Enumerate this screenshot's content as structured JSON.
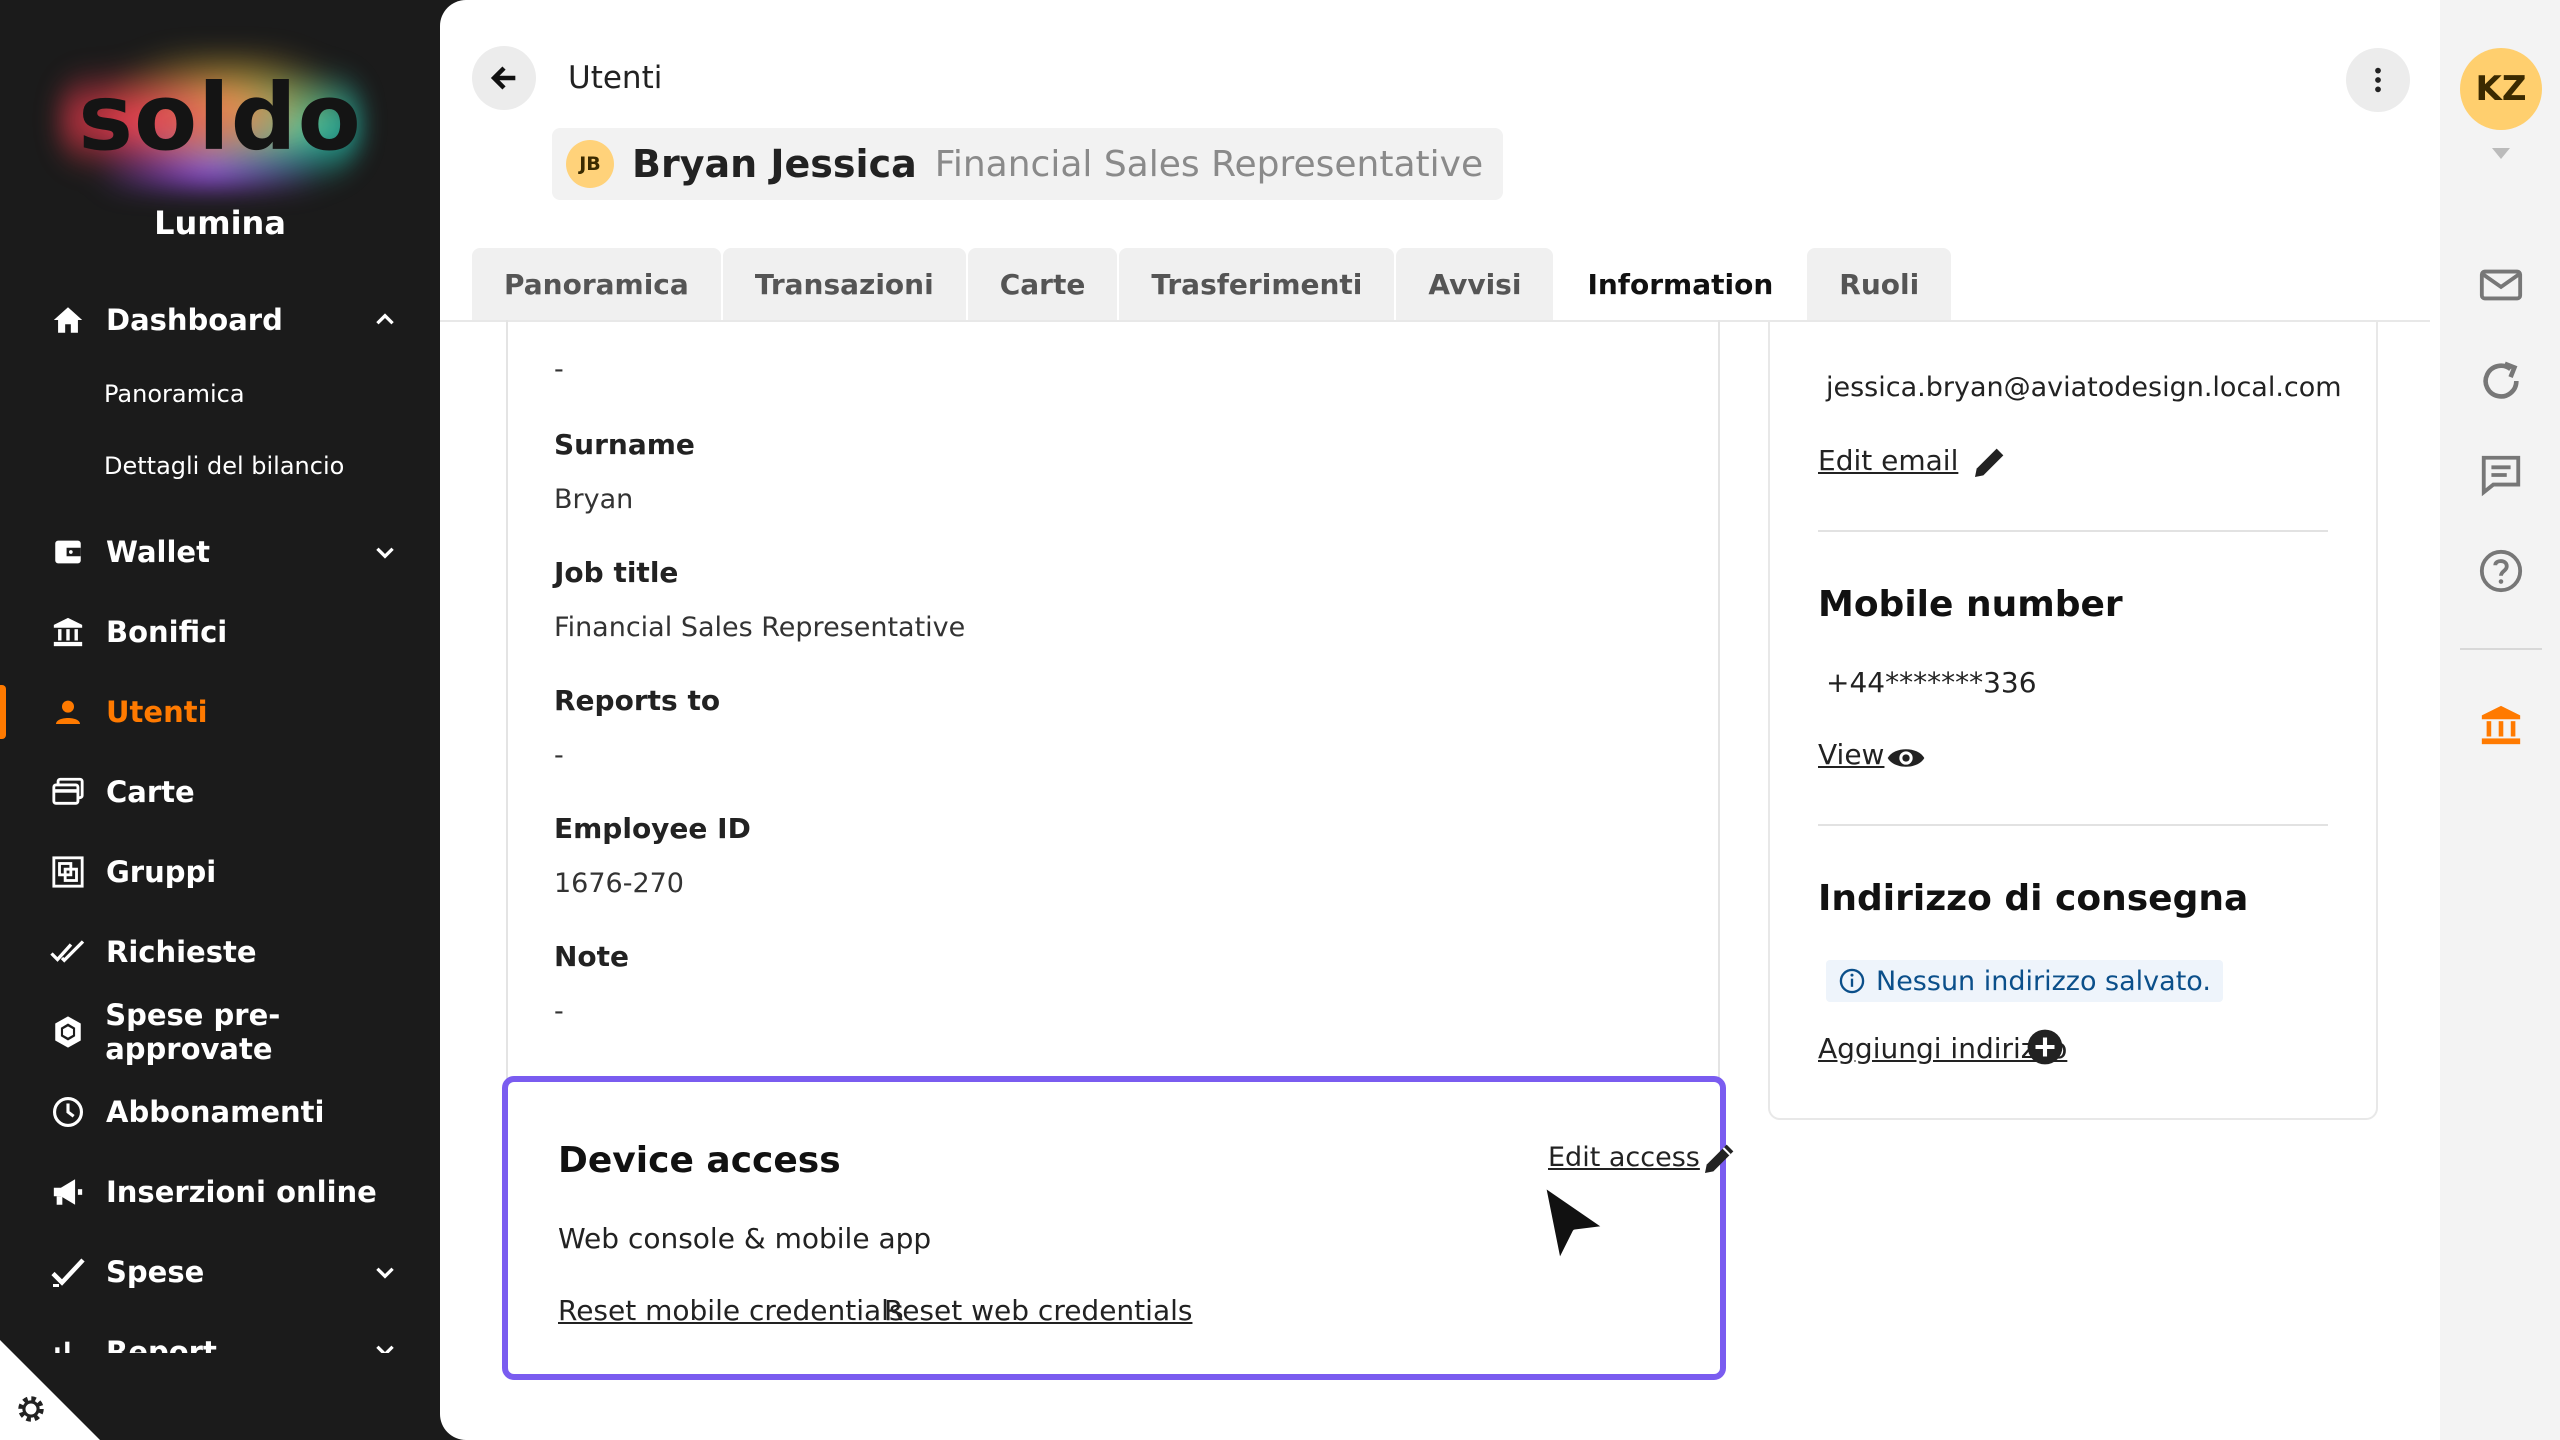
{
  "brand": {
    "logo_text": "soldo",
    "org_name": "Lumina"
  },
  "sidebar": {
    "items": [
      {
        "label": "Dashboard",
        "icon": "home-icon",
        "expanded": true
      },
      {
        "label": "Wallet",
        "icon": "wallet-icon"
      },
      {
        "label": "Bonifici",
        "icon": "bank-transfer-icon"
      },
      {
        "label": "Utenti",
        "icon": "user-icon",
        "active": true
      },
      {
        "label": "Carte",
        "icon": "cards-icon"
      },
      {
        "label": "Gruppi",
        "icon": "groups-icon"
      },
      {
        "label": "Richieste",
        "icon": "double-check-icon"
      },
      {
        "label": "Spese pre-approvate",
        "icon": "shield-icon"
      },
      {
        "label": "Abbonamenti",
        "icon": "clock-icon"
      },
      {
        "label": "Inserzioni online",
        "icon": "megaphone-icon"
      },
      {
        "label": "Spese",
        "icon": "check-icon"
      },
      {
        "label": "Report",
        "icon": "chart-icon"
      }
    ],
    "dashboard_sub": [
      "Panoramica",
      "Dettagli del bilancio"
    ]
  },
  "header": {
    "breadcrumb": "Utenti",
    "user_initials": "JB",
    "user_name": "Bryan Jessica",
    "user_role": "Financial Sales Representative"
  },
  "tabs": [
    {
      "label": "Panoramica"
    },
    {
      "label": "Transazioni"
    },
    {
      "label": "Carte"
    },
    {
      "label": "Trasferimenti"
    },
    {
      "label": "Avvisi"
    },
    {
      "label": "Information",
      "active": true
    },
    {
      "label": "Ruoli"
    }
  ],
  "details": {
    "top_value": "-",
    "surname_label": "Surname",
    "surname_value": "Bryan",
    "job_label": "Job title",
    "job_value": "Financial Sales Representative",
    "reports_label": "Reports to",
    "reports_value": "-",
    "employee_label": "Employee ID",
    "employee_value": "1676-270",
    "note_label": "Note",
    "note_value": "-"
  },
  "device": {
    "title": "Device access",
    "value": "Web console & mobile app",
    "edit_label": "Edit access",
    "reset_mobile": "Reset mobile credentials",
    "reset_web": "Reset web credentials",
    "accent": "#7a5cf0"
  },
  "contact": {
    "email": "jessica.bryan@aviatodesign.local.com",
    "edit_email": "Edit email",
    "mobile_title": "Mobile number",
    "mobile_value": "+44*******336",
    "view_label": "View",
    "address_title": "Indirizzo di consegna",
    "address_empty": "Nessun indirizzo salvato.",
    "add_address": "Aggiungi indirizzo"
  },
  "rail": {
    "avatar": "KZ",
    "icons": [
      "mail-icon",
      "refresh-icon",
      "chat-icon",
      "help-icon",
      "bank-icon"
    ]
  },
  "colors": {
    "accent_orange": "#ff7a00",
    "sidebar_bg": "#1b1b1b",
    "info_blue": "#0b4f8a"
  }
}
